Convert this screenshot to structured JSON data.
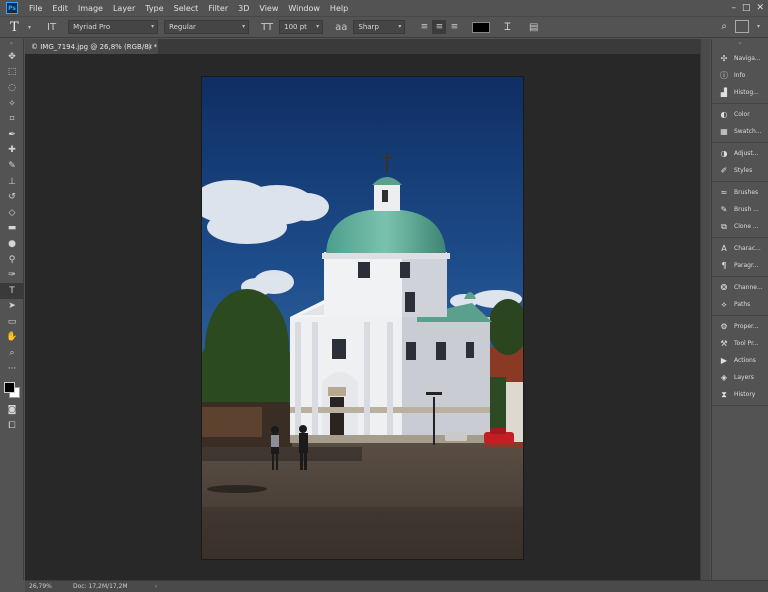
{
  "app": {
    "logo_text": "Ps"
  },
  "menu": [
    "File",
    "Edit",
    "Image",
    "Layer",
    "Type",
    "Select",
    "Filter",
    "3D",
    "View",
    "Window",
    "Help"
  ],
  "window_controls": {
    "minimize": "–",
    "maximize": "□",
    "close": "✕"
  },
  "options": {
    "tool_glyph": "T",
    "orientation_glyph": "IT",
    "font_family": "Myriad Pro",
    "font_style": "Regular",
    "size_glyph": "TT",
    "font_size": "100 pt",
    "aa_glyph": "aa",
    "anti_alias": "Sharp",
    "text_color": "#000000"
  },
  "document": {
    "tab_title": "© IMG_7194.jpg @ 26,8% (RGB/8) *",
    "close_glyph": "×"
  },
  "status": {
    "zoom": "26,79%",
    "doc_size": "Doc: 17,2M/17,2M",
    "arrow": "›"
  },
  "panels": [
    [
      {
        "icon": "navigator-icon",
        "glyph": "✣",
        "label": "Naviga..."
      },
      {
        "icon": "info-icon",
        "glyph": "ⓘ",
        "label": "Info"
      },
      {
        "icon": "histogram-icon",
        "glyph": "▟",
        "label": "Histog..."
      }
    ],
    [
      {
        "icon": "color-icon",
        "glyph": "◐",
        "label": "Color"
      },
      {
        "icon": "swatches-icon",
        "glyph": "▦",
        "label": "Swatch..."
      }
    ],
    [
      {
        "icon": "adjustments-icon",
        "glyph": "◑",
        "label": "Adjust..."
      },
      {
        "icon": "styles-icon",
        "glyph": "✐",
        "label": "Styles"
      }
    ],
    [
      {
        "icon": "brushes-icon",
        "glyph": "≈",
        "label": "Brushes"
      },
      {
        "icon": "brush-settings-icon",
        "glyph": "✎",
        "label": "Brush ..."
      },
      {
        "icon": "clone-source-icon",
        "glyph": "⧉",
        "label": "Clone ..."
      }
    ],
    [
      {
        "icon": "character-icon",
        "glyph": "A",
        "label": "Charac..."
      },
      {
        "icon": "paragraph-icon",
        "glyph": "¶",
        "label": "Paragr..."
      }
    ],
    [
      {
        "icon": "channels-icon",
        "glyph": "❂",
        "label": "Channe..."
      },
      {
        "icon": "paths-icon",
        "glyph": "⟡",
        "label": "Paths"
      }
    ],
    [
      {
        "icon": "properties-icon",
        "glyph": "⚙",
        "label": "Proper..."
      },
      {
        "icon": "tool-presets-icon",
        "glyph": "⚒",
        "label": "Tool Pr..."
      },
      {
        "icon": "actions-icon",
        "glyph": "▶",
        "label": "Actions"
      },
      {
        "icon": "layers-icon",
        "glyph": "◈",
        "label": "Layers"
      },
      {
        "icon": "history-icon",
        "glyph": "⧗",
        "label": "History"
      }
    ]
  ],
  "tools": [
    {
      "name": "move-tool-icon",
      "glyph": "✥"
    },
    {
      "name": "marquee-tool-icon",
      "glyph": "⬚"
    },
    {
      "name": "lasso-tool-icon",
      "glyph": "◌"
    },
    {
      "name": "quick-select-tool-icon",
      "glyph": "✧"
    },
    {
      "name": "crop-tool-icon",
      "glyph": "⌗"
    },
    {
      "name": "eyedropper-tool-icon",
      "glyph": "✒"
    },
    {
      "name": "healing-tool-icon",
      "glyph": "✚"
    },
    {
      "name": "brush-tool-icon",
      "glyph": "✎"
    },
    {
      "name": "clone-stamp-tool-icon",
      "glyph": "⊥"
    },
    {
      "name": "history-brush-tool-icon",
      "glyph": "↺"
    },
    {
      "name": "eraser-tool-icon",
      "glyph": "◇"
    },
    {
      "name": "gradient-tool-icon",
      "glyph": "▬"
    },
    {
      "name": "blur-tool-icon",
      "glyph": "●"
    },
    {
      "name": "dodge-tool-icon",
      "glyph": "⚲"
    },
    {
      "name": "pen-tool-icon",
      "glyph": "✑"
    },
    {
      "name": "type-tool-icon",
      "glyph": "T"
    },
    {
      "name": "path-select-tool-icon",
      "glyph": "➤"
    },
    {
      "name": "shape-tool-icon",
      "glyph": "▭"
    },
    {
      "name": "hand-tool-icon",
      "glyph": "✋"
    },
    {
      "name": "zoom-tool-icon",
      "glyph": "⌕"
    },
    {
      "name": "more-tools-icon",
      "glyph": "···"
    }
  ],
  "extra_tools": [
    {
      "name": "quick-mask-icon",
      "glyph": "◙"
    },
    {
      "name": "screen-mode-icon",
      "glyph": "⧠"
    }
  ]
}
